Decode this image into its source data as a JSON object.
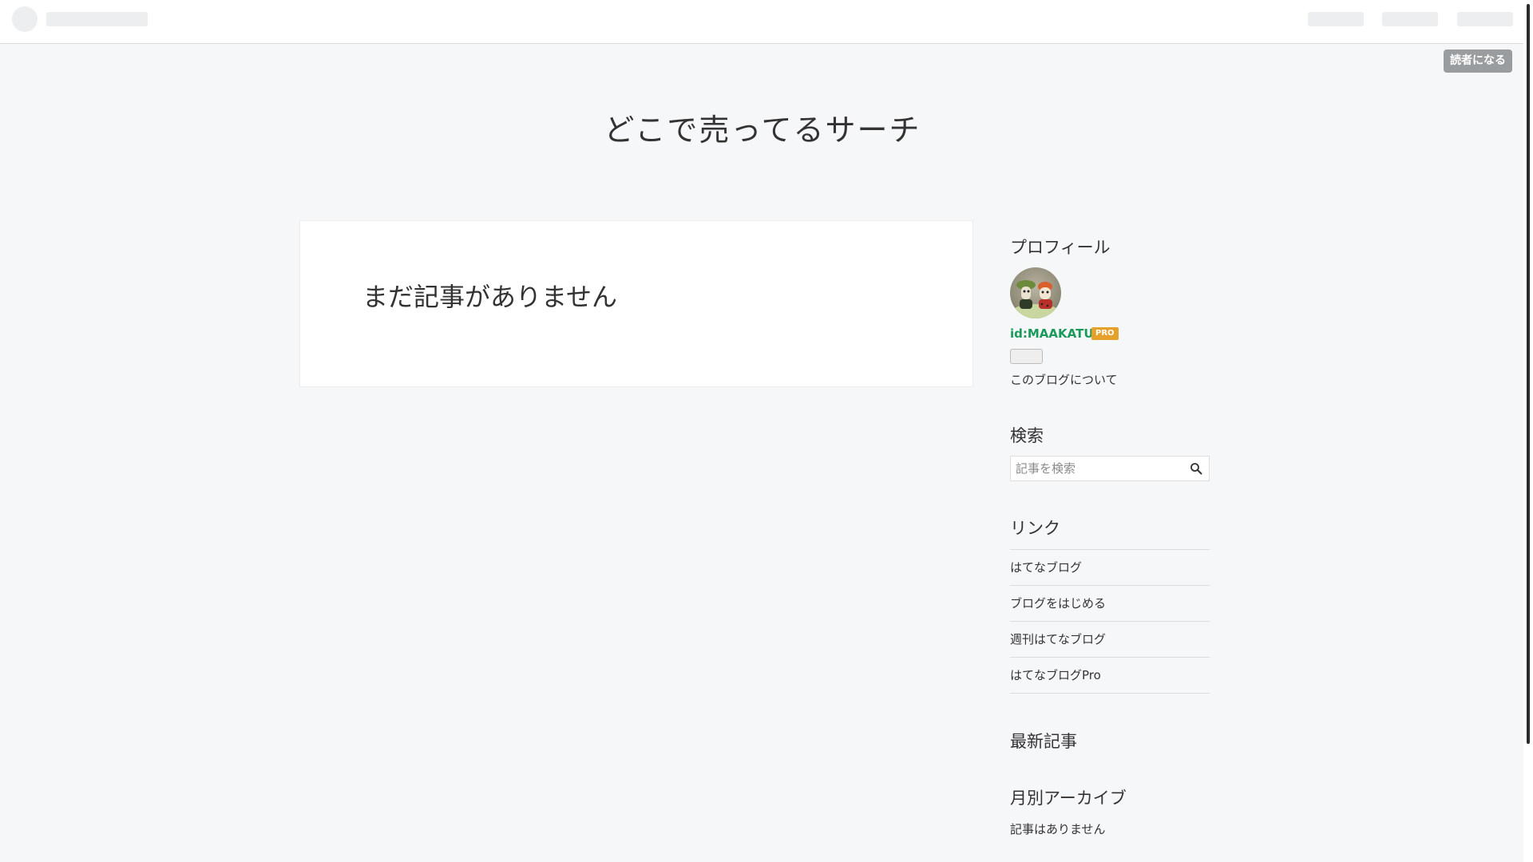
{
  "header": {
    "subscribe_label": "読者になる"
  },
  "blog": {
    "title": "どこで売ってるサーチ"
  },
  "main": {
    "empty_message": "まだ記事がありません"
  },
  "sidebar": {
    "profile": {
      "title": "プロフィール",
      "user_id": "id:MAAKATU",
      "badge": "PRO",
      "about_link": "このブログについて"
    },
    "search": {
      "title": "検索",
      "placeholder": "記事を検索",
      "icon": "search-icon"
    },
    "links": {
      "title": "リンク",
      "items": [
        "はてなブログ",
        "ブログをはじめる",
        "週刊はてなブログ",
        "はてなブログPro"
      ]
    },
    "recent": {
      "title": "最新記事"
    },
    "archive": {
      "title": "月別アーカイブ",
      "empty": "記事はありません"
    }
  },
  "colors": {
    "background": "#f6f7f8",
    "user_id": "#1a9a5a",
    "pro_badge": "#e6a12b",
    "subscribe_button": "#9a9d9f"
  }
}
